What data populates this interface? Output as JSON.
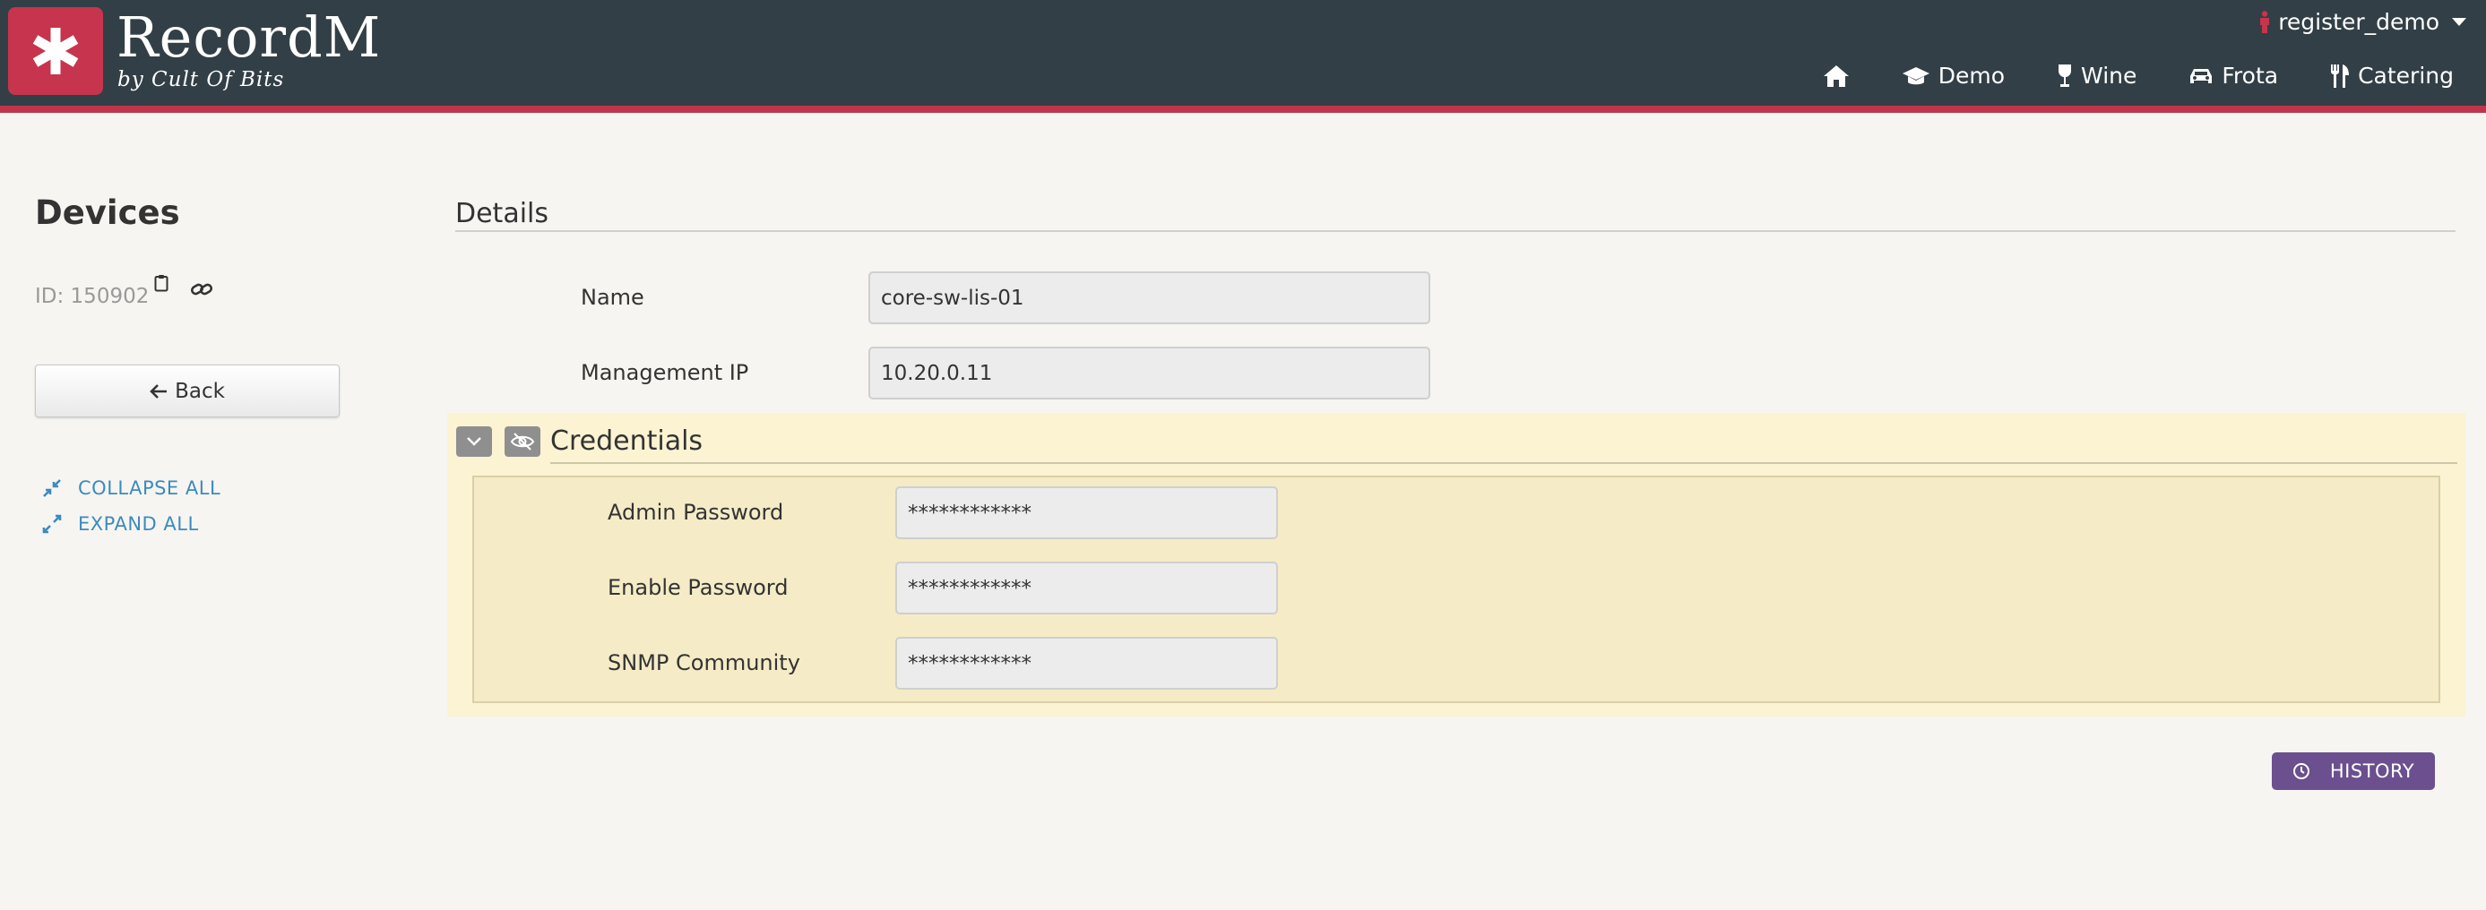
{
  "header": {
    "brand": "RecordM",
    "brand_sub": "by Cult Of Bits",
    "user": "register_demo",
    "nav": [
      {
        "label": "",
        "icon": "home-icon"
      },
      {
        "label": "Demo",
        "icon": "graduation-cap-icon"
      },
      {
        "label": "Wine",
        "icon": "wine-glass-icon"
      },
      {
        "label": "Frota",
        "icon": "car-icon"
      },
      {
        "label": "Catering",
        "icon": "utensils-icon"
      }
    ],
    "colors": {
      "bar": "#323f46",
      "accent": "#c0354c"
    }
  },
  "sidebar": {
    "title": "Devices",
    "id_text": "ID: 150902",
    "back_label": "Back",
    "collapse_all": "COLLAPSE ALL",
    "expand_all": "EXPAND ALL"
  },
  "details": {
    "title": "Details",
    "fields": [
      {
        "label": "Name",
        "value": "core-sw-lis-01"
      },
      {
        "label": "Management IP",
        "value": "10.20.0.11"
      }
    ]
  },
  "credentials": {
    "title": "Credentials",
    "fields": [
      {
        "label": "Admin Password",
        "value": "************"
      },
      {
        "label": "Enable Password",
        "value": "************"
      },
      {
        "label": "SNMP Community",
        "value": "************"
      }
    ]
  },
  "history_label": "HISTORY"
}
